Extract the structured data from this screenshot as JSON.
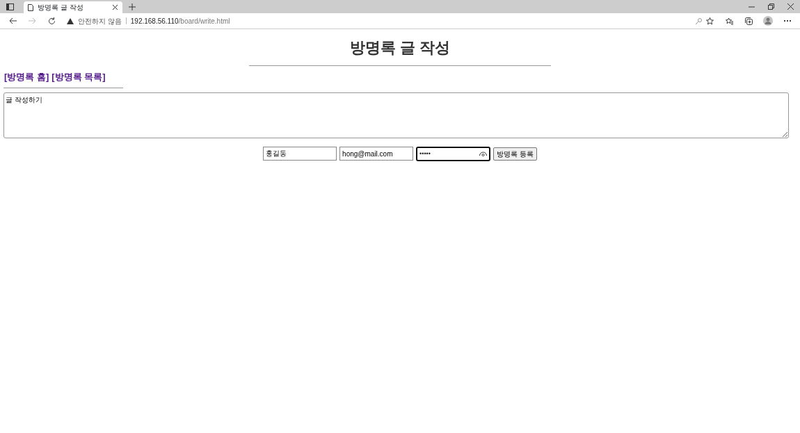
{
  "browser": {
    "tab_title": "방명록 글 작성",
    "security_label": "안전하지 않음",
    "url_host": "192.168.56.110",
    "url_path": "/board/write.html"
  },
  "page": {
    "heading": "방명록 글 작성",
    "links": [
      {
        "label": "[방명록 홈]"
      },
      {
        "label": "[방명록 목록]"
      }
    ],
    "content": {
      "value": "글 작성하기"
    },
    "name": {
      "value": "홍길동"
    },
    "email": {
      "value": "hong@mail.com"
    },
    "password": {
      "mask": "•••••",
      "focused": true
    },
    "submit": "방명록 등록"
  }
}
